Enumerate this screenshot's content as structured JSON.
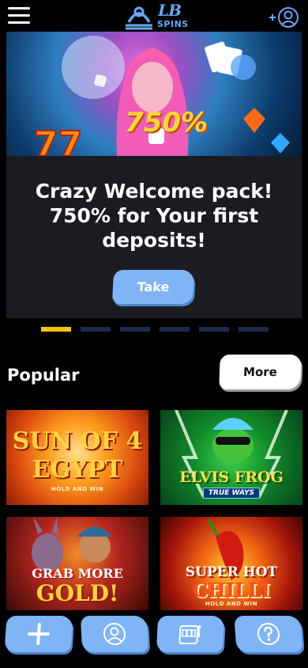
{
  "header": {
    "logo_lb": "LB",
    "logo_spins": "SPINS"
  },
  "banner": {
    "art_text": "750%",
    "title": "Crazy Welcome pack! 750% for Your first deposits!",
    "button_label": "Take",
    "slides": 6,
    "active_slide": 1
  },
  "popular": {
    "title": "Popular",
    "more_label": "More",
    "games": [
      {
        "title_line1": "SUN OF 4",
        "title_line2": "EGYPT",
        "subtitle": "HOLD AND WIN"
      },
      {
        "title_line1": "ELVIS FROG",
        "subtitle": "TRUE WAYS"
      },
      {
        "title_line1": "GRAB MORE",
        "title_line2": "GOLD!"
      },
      {
        "title_line1": "SUPER HOT",
        "title_line2": "CHILLI",
        "subtitle": "HOLD AND WIN"
      }
    ]
  },
  "colors": {
    "accent": "#7fb4f5",
    "active_dot": "#f1c40f",
    "background": "#000000",
    "banner_bg": "#1b1c22"
  }
}
